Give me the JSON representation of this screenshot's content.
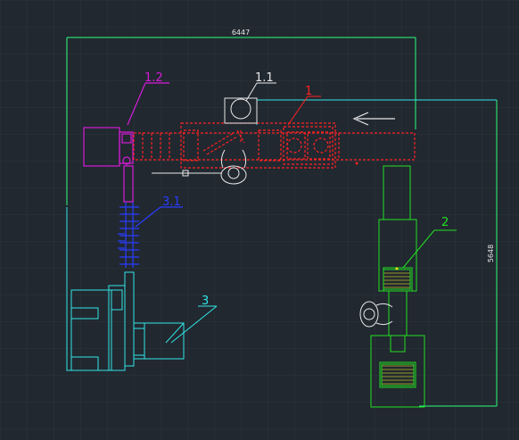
{
  "dimensions": {
    "width_label": "6447",
    "height_label": "5648"
  },
  "callouts": {
    "conveyor_main": "1",
    "unit_1_1": "1.1",
    "unit_1_2": "1.2",
    "machine_2": "2",
    "machine_3": "3",
    "conveyor_3_1": "3.1"
  },
  "colors": {
    "background": "#212830",
    "grid": "#2b333d",
    "dimension_lines": "#2bff7a",
    "outline_cyan": "#31e6e6",
    "conveyor_red": "#ff2222",
    "magenta": "#d81bd8",
    "blue": "#2a3cff",
    "green": "#22e022",
    "white": "#e8e8e8",
    "yellow": "#e6e61e"
  }
}
